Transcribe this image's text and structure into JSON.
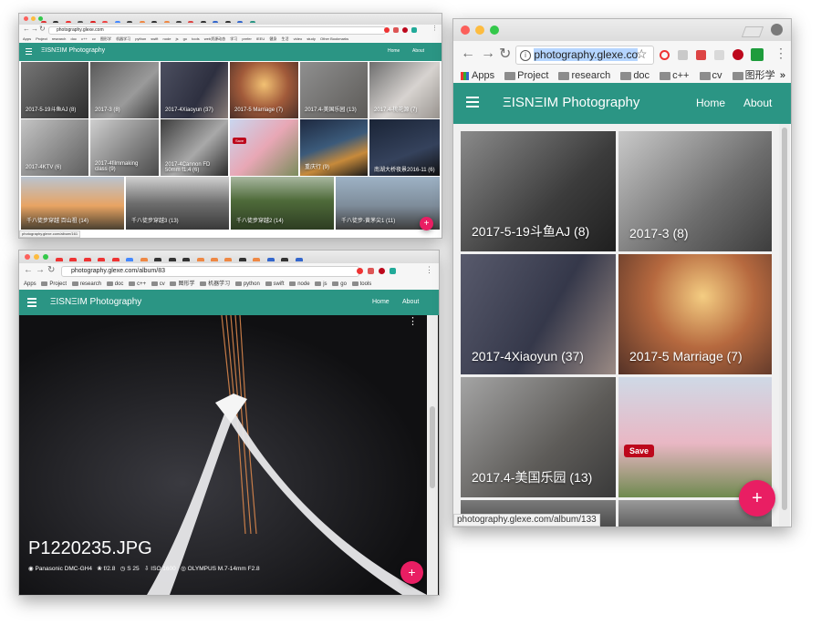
{
  "win1": {
    "url": "photography.glexe.com",
    "status_url": "photography.glexe.com/album/161",
    "bookmarks": [
      "Apps",
      "Project",
      "research",
      "doc",
      "c++",
      "cv",
      "图形学",
      "机器学习",
      "python",
      "swift",
      "node",
      "js",
      "go",
      "tools",
      "web资源动态",
      "学习",
      "prefer",
      "IEEU",
      "健身",
      "生活",
      "video",
      "study",
      "Other Bookmarks"
    ],
    "brand": "ΞISNΞIM Photography",
    "nav": [
      "Home",
      "About"
    ],
    "albums": [
      "2017-5-19斗鱼AJ (8)",
      "2017-3 (8)",
      "2017-4Xiaoyun (37)",
      "2017-5 Marriage (7)",
      "2017.4-美国乐园 (13)",
      "2017.4-桃花源 (7)",
      "2017-4KTV (6)",
      "2017-4filmmaking class (9)",
      "2017-4Cannon FD 50mm f1.4 (6)",
      "",
      "重庆行 (9)",
      "南湖大桥夜景2016-11 (6)",
      "千八徒步穿越 百山祖 (14)",
      "千八徒步穿越3 (13)",
      "千八徒步穿越2 (14)",
      "千八徒步-黄茅尖1 (11)"
    ],
    "pin_save": "Save",
    "fab": "+"
  },
  "win2": {
    "url": "photography.glexe.com/album/83",
    "bookmarks": [
      "Apps",
      "Project",
      "research",
      "doc",
      "c++",
      "cv",
      "图形学",
      "机器学习",
      "python",
      "swift",
      "node",
      "js",
      "go",
      "tools"
    ],
    "brand": "ΞISNΞIM Photography",
    "nav": [
      "Home",
      "About"
    ],
    "photo_title": "P1220235.JPG",
    "exif": {
      "camera": "Panasonic DMC-GH4",
      "aperture": "f/2.8",
      "shutter": "S 25",
      "iso": "ISO 1600",
      "lens": "OLYMPUS M.7-14mm F2.8"
    },
    "menu_dots": "⋮",
    "fab": "+"
  },
  "win3": {
    "url": "photography.glexe.co",
    "bookmarks": [
      "Apps",
      "Project",
      "research",
      "doc",
      "c++",
      "cv",
      "图形学"
    ],
    "brand": "ΞISNΞIM Photography",
    "nav": [
      "Home",
      "About"
    ],
    "albums": [
      "2017-5-19斗鱼AJ (8)",
      "2017-3 (8)",
      "2017-4Xiaoyun (37)",
      "2017-5 Marriage (7)",
      "2017.4-美国乐园 (13)",
      ""
    ],
    "pin_save": "Save",
    "status_url": "photography.glexe.com/album/133",
    "fab": "+",
    "more": "»"
  },
  "colors": {
    "appbar": "#2b9584",
    "fab": "#e91e63",
    "pin": "#bd081c"
  },
  "icons": [
    "back-icon",
    "forward-icon",
    "reload-icon",
    "info-icon",
    "star-icon",
    "opera-icon",
    "pinterest-icon",
    "menu-icon",
    "folder-icon",
    "apps-icon",
    "plus-icon",
    "camera-icon",
    "aperture-icon",
    "timer-icon",
    "iso-icon",
    "lens-icon",
    "more-vert-icon"
  ]
}
